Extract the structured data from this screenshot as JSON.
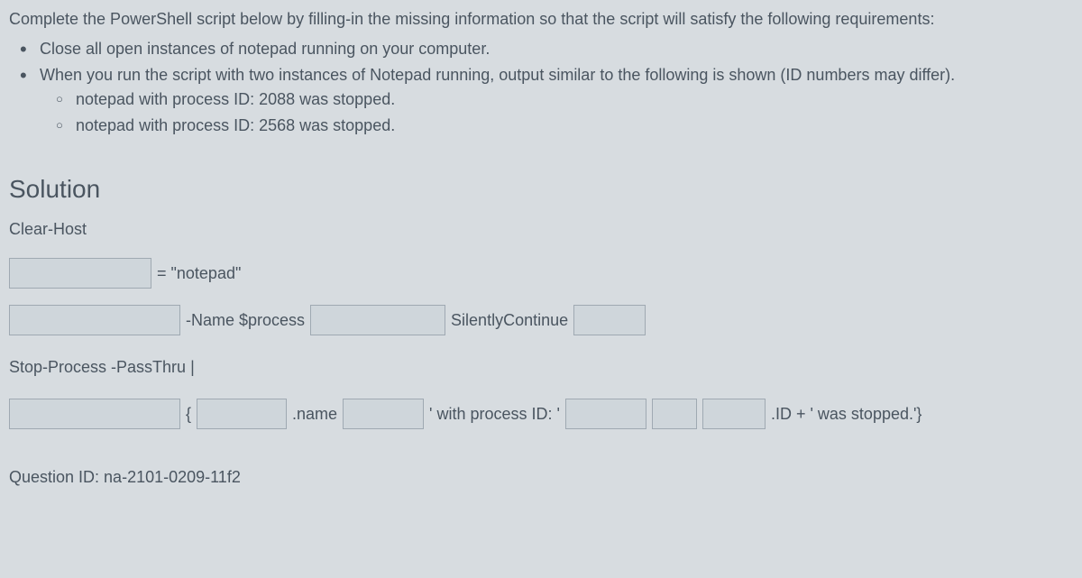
{
  "intro": "Complete the PowerShell script below by filling-in the missing information so that the script will satisfy the following requirements:",
  "req1": "Close all open instances of notepad running on your computer.",
  "req2": "When you run the script with two instances of Notepad running, output similar to the following is shown (ID numbers may differ).",
  "sub1": "notepad with process ID: 2088 was stopped.",
  "sub2": "notepad with process ID: 2568 was stopped.",
  "solution_heading": "Solution",
  "clear_host": "Clear-Host",
  "line1": {
    "eq_notepad": "= \"notepad\""
  },
  "line2": {
    "name_process": "-Name $process",
    "silently": "SilentlyContinue"
  },
  "line3": {
    "stop_process": "Stop-Process -PassThru |"
  },
  "line4": {
    "brace": "{",
    "dot_name": ".name",
    "with_pid": "' with process ID: '",
    "id_stopped": ".ID + ' was stopped.'}"
  },
  "question_id": "Question ID: na-2101-0209-11f2"
}
